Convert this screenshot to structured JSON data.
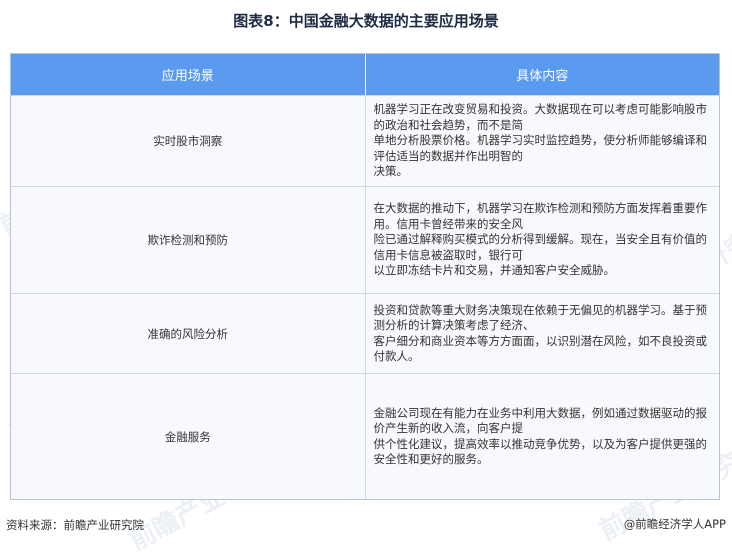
{
  "title": "图表8：中国金融大数据的主要应用场景",
  "table": {
    "headers": [
      "应用场景",
      "具体内容"
    ],
    "rows": [
      {
        "scene": "实时股市洞察",
        "desc_lines": [
          "机器学习正在改变贸易和投资。大数据现在可以考虑可能影响股市的政治和社会趋势，而不是简",
          "单地分析股票价格。机器学习实时监控趋势，使分析师能够编译和评估适当的数据并作出明智的",
          "决策。"
        ]
      },
      {
        "scene": "欺诈检测和预防",
        "desc_lines": [
          "在大数据的推动下，机器学习在欺诈检测和预防方面发挥着重要作用。信用卡曾经带来的安全风",
          "险已通过解释购买模式的分析得到缓解。现在，当安全且有价值的信用卡信息被盗取时，银行可",
          "以立即冻结卡片和交易，并通知客户安全威胁。"
        ]
      },
      {
        "scene": "准确的风险分析",
        "desc_lines": [
          "投资和贷款等重大财务决策现在依赖于无偏见的机器学习。基于预测分析的计算决策考虑了经济、",
          "客户细分和商业资本等方方面面，以识别潜在风险，如不良投资或付款人。"
        ]
      },
      {
        "scene": "金融服务",
        "desc_lines": [
          "金融公司现在有能力在业务中利用大数据，例如通过数据驱动的报价产生新的收入流，向客户提",
          "供个性化建议，提高效率以推动竞争优势，以及为客户提供更强的安全性和更好的服务。"
        ]
      }
    ]
  },
  "watermark": "前瞻产业研究院",
  "footer": {
    "source": "资料来源：前瞻产业研究院",
    "brand": "@前瞻经济学人APP"
  }
}
